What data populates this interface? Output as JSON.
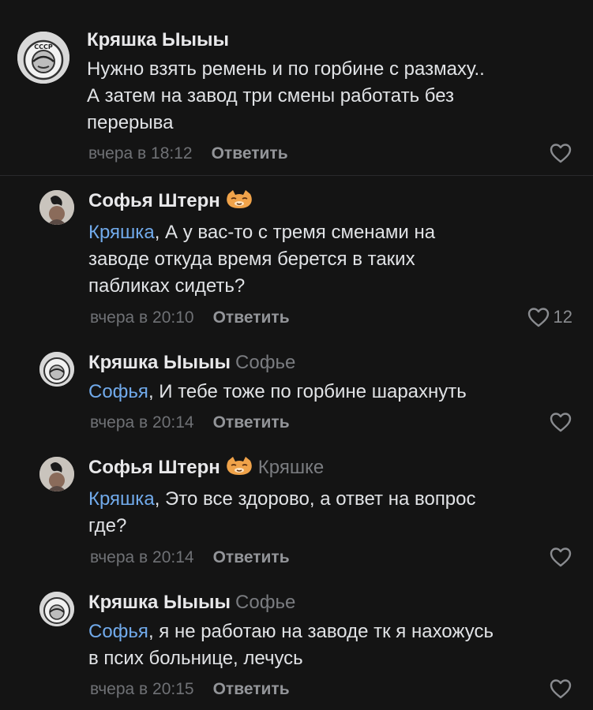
{
  "comments": [
    {
      "author": "Кряшка Ыыыы",
      "reply_to": "",
      "mention": "",
      "text_lines": [
        "Нужно взять ремень и по горбине с размаху..",
        "А затем на завод три смены работать без",
        "перерыва"
      ],
      "time": "вчера в 18:12",
      "reply_label": "Ответить",
      "likes": ""
    },
    {
      "author": "Софья Штерн",
      "reply_to": "",
      "mention": "Кряшка",
      "text_lines": [
        ", А у вас-то с тремя сменами на",
        "заводе откуда время берется в таких",
        "пабликах сидеть?"
      ],
      "time": "вчера в 20:10",
      "reply_label": "Ответить",
      "likes": "12"
    },
    {
      "author": "Кряшка Ыыыы",
      "reply_to": "Софье",
      "mention": "Софья",
      "text_lines": [
        ", И тебе тоже по горбине шарахнуть"
      ],
      "time": "вчера в 20:14",
      "reply_label": "Ответить",
      "likes": ""
    },
    {
      "author": "Софья Штерн",
      "reply_to": "Кряшке",
      "mention": "Кряшка",
      "text_lines": [
        ", Это все здорово, а ответ на вопрос",
        "где?"
      ],
      "time": "вчера в 20:14",
      "reply_label": "Ответить",
      "likes": ""
    },
    {
      "author": "Кряшка Ыыыы",
      "reply_to": "Софье",
      "mention": "Софья",
      "text_lines": [
        ", я не работаю на заводе тк я нахожусь",
        "в псих больнице, лечусь"
      ],
      "time": "вчера в 20:15",
      "reply_label": "Ответить",
      "likes": ""
    }
  ],
  "icons": {
    "like": "heart-outline-icon",
    "cat_emoji": "cat-face-emoji"
  },
  "colors": {
    "background": "#141414",
    "mention": "#71aaeb",
    "meta": "#6f7175"
  }
}
